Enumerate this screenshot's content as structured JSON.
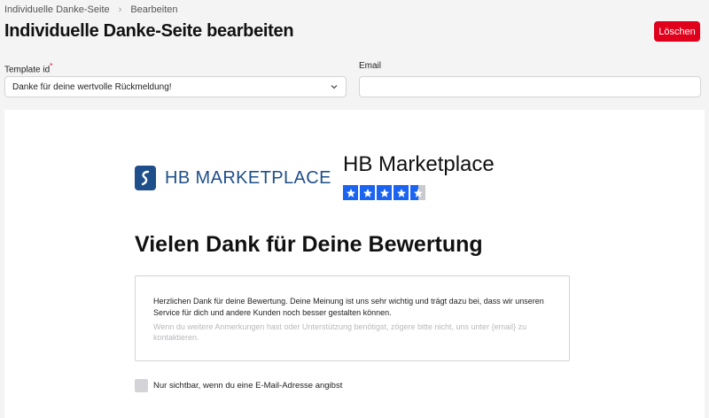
{
  "breadcrumb": {
    "items": [
      "Individuelle Danke-Seite",
      "Bearbeiten"
    ]
  },
  "header": {
    "title": "Individuelle Danke-Seite bearbeiten",
    "delete_label": "Löschen"
  },
  "form": {
    "template_label": "Template id",
    "template_required_mark": "*",
    "template_value": "Danke für deine wertvolle Rückmeldung!",
    "email_label": "Email",
    "email_value": ""
  },
  "preview": {
    "logo_text": "HB MARKETPLACE",
    "company_name": "HB Marketplace",
    "rating": 4.5,
    "rating_max": 5,
    "heading": "Vielen Dank für Deine Bewertung",
    "message_main": "Herzlichen Dank für deine Bewertung. Deine Meinung ist uns sehr wichtig und trägt dazu bei, dass wir unseren Service für dich und andere Kunden noch besser gestalten können.",
    "message_secondary": "Wenn du weitere Anmerkungen hast oder Unterstützung benötigst, zögere bitte nicht, uns unter {email} zu kontaktieren.",
    "checkbox_label": "Nur sichtbar, wenn du eine E-Mail-Adresse angibst"
  },
  "colors": {
    "accent_red": "#e0001b",
    "brand_blue": "#1e4f8a",
    "star_blue": "#1b64f2"
  }
}
